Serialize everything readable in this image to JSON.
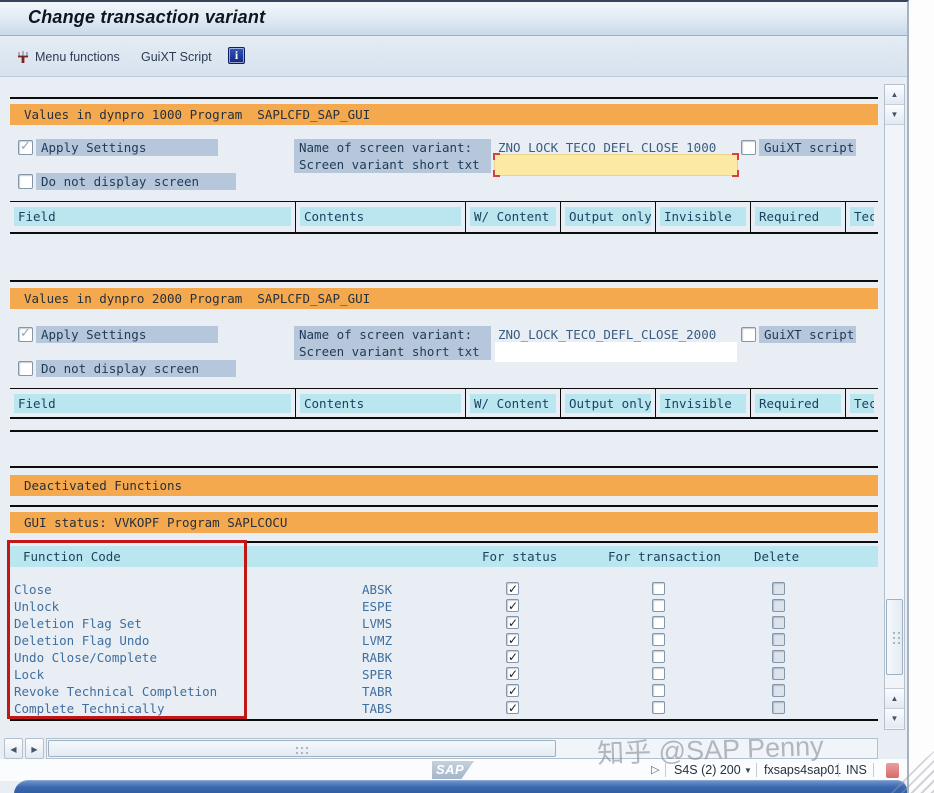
{
  "window": {
    "title": "Change transaction variant"
  },
  "toolbar": {
    "menu_functions": "Menu functions",
    "guixt_script": "GuiXT Script",
    "info_glyph": "i"
  },
  "sections": [
    {
      "header": "Values in dynpro 1000 Program  SAPLCFD_SAP_GUI",
      "apply_settings_label": "Apply Settings",
      "apply_settings_checked": true,
      "do_not_display_label": "Do not display screen",
      "do_not_display_checked": false,
      "variant_name_label": "Name of screen variant:",
      "variant_name_value": "ZNO_LOCK_TECO_DEFL_CLOSE_1000",
      "guixt_label": "GuiXT script",
      "guixt_checked": false,
      "short_txt_label": "Screen variant short txt",
      "short_txt_value": "",
      "table_headers": [
        "Field",
        "Contents",
        "W/ Content",
        "Output only",
        "Invisible",
        "Required",
        "Tec"
      ]
    },
    {
      "header": "Values in dynpro 2000 Program  SAPLCFD_SAP_GUI",
      "apply_settings_label": "Apply Settings",
      "apply_settings_checked": true,
      "do_not_display_label": "Do not display screen",
      "do_not_display_checked": false,
      "variant_name_label": "Name of screen variant:",
      "variant_name_value": "ZNO_LOCK_TECO_DEFL_CLOSE_2000",
      "guixt_label": "GuiXT script",
      "guixt_checked": false,
      "short_txt_label": "Screen variant short txt",
      "short_txt_value": "",
      "table_headers": [
        "Field",
        "Contents",
        "W/ Content",
        "Output only",
        "Invisible",
        "Required",
        "Tec"
      ]
    }
  ],
  "deactivated_functions": {
    "header": "Deactivated Functions",
    "gui_status_header": "GUI status: VVKOPF Program SAPLCOCU",
    "columns": [
      "Function Code",
      "For status",
      "For transaction",
      "Delete"
    ],
    "rows": [
      {
        "label": "Close",
        "code": "ABSK",
        "for_status": true,
        "for_transaction": false,
        "delete": false
      },
      {
        "label": "Unlock",
        "code": "ESPE",
        "for_status": true,
        "for_transaction": false,
        "delete": false
      },
      {
        "label": "Deletion Flag Set",
        "code": "LVMS",
        "for_status": true,
        "for_transaction": false,
        "delete": false
      },
      {
        "label": "Deletion Flag Undo",
        "code": "LVMZ",
        "for_status": true,
        "for_transaction": false,
        "delete": false
      },
      {
        "label": "Undo Close/Complete",
        "code": "RABK",
        "for_status": true,
        "for_transaction": false,
        "delete": false
      },
      {
        "label": "Lock",
        "code": "SPER",
        "for_status": true,
        "for_transaction": false,
        "delete": false
      },
      {
        "label": "Revoke Technical Completion",
        "code": "TABR",
        "for_status": true,
        "for_transaction": false,
        "delete": false
      },
      {
        "label": "Complete Technically",
        "code": "TABS",
        "for_status": true,
        "for_transaction": false,
        "delete": false
      }
    ]
  },
  "status_bar": {
    "system": "S4S (2) 200",
    "host": "fxsaps4sap01",
    "mode": "INS"
  },
  "branding": {
    "logo": "SAP",
    "watermark": "知乎 @SAP Penny"
  },
  "colors": {
    "section_header_bg": "#f5a94e",
    "table_header_bg": "#b9e6ef",
    "label_highlight_bg": "#b7c7db",
    "focused_field_bg": "#fce9a4",
    "annotation_red": "#c21717",
    "bottom_bar_blue": "#3a67ae"
  }
}
